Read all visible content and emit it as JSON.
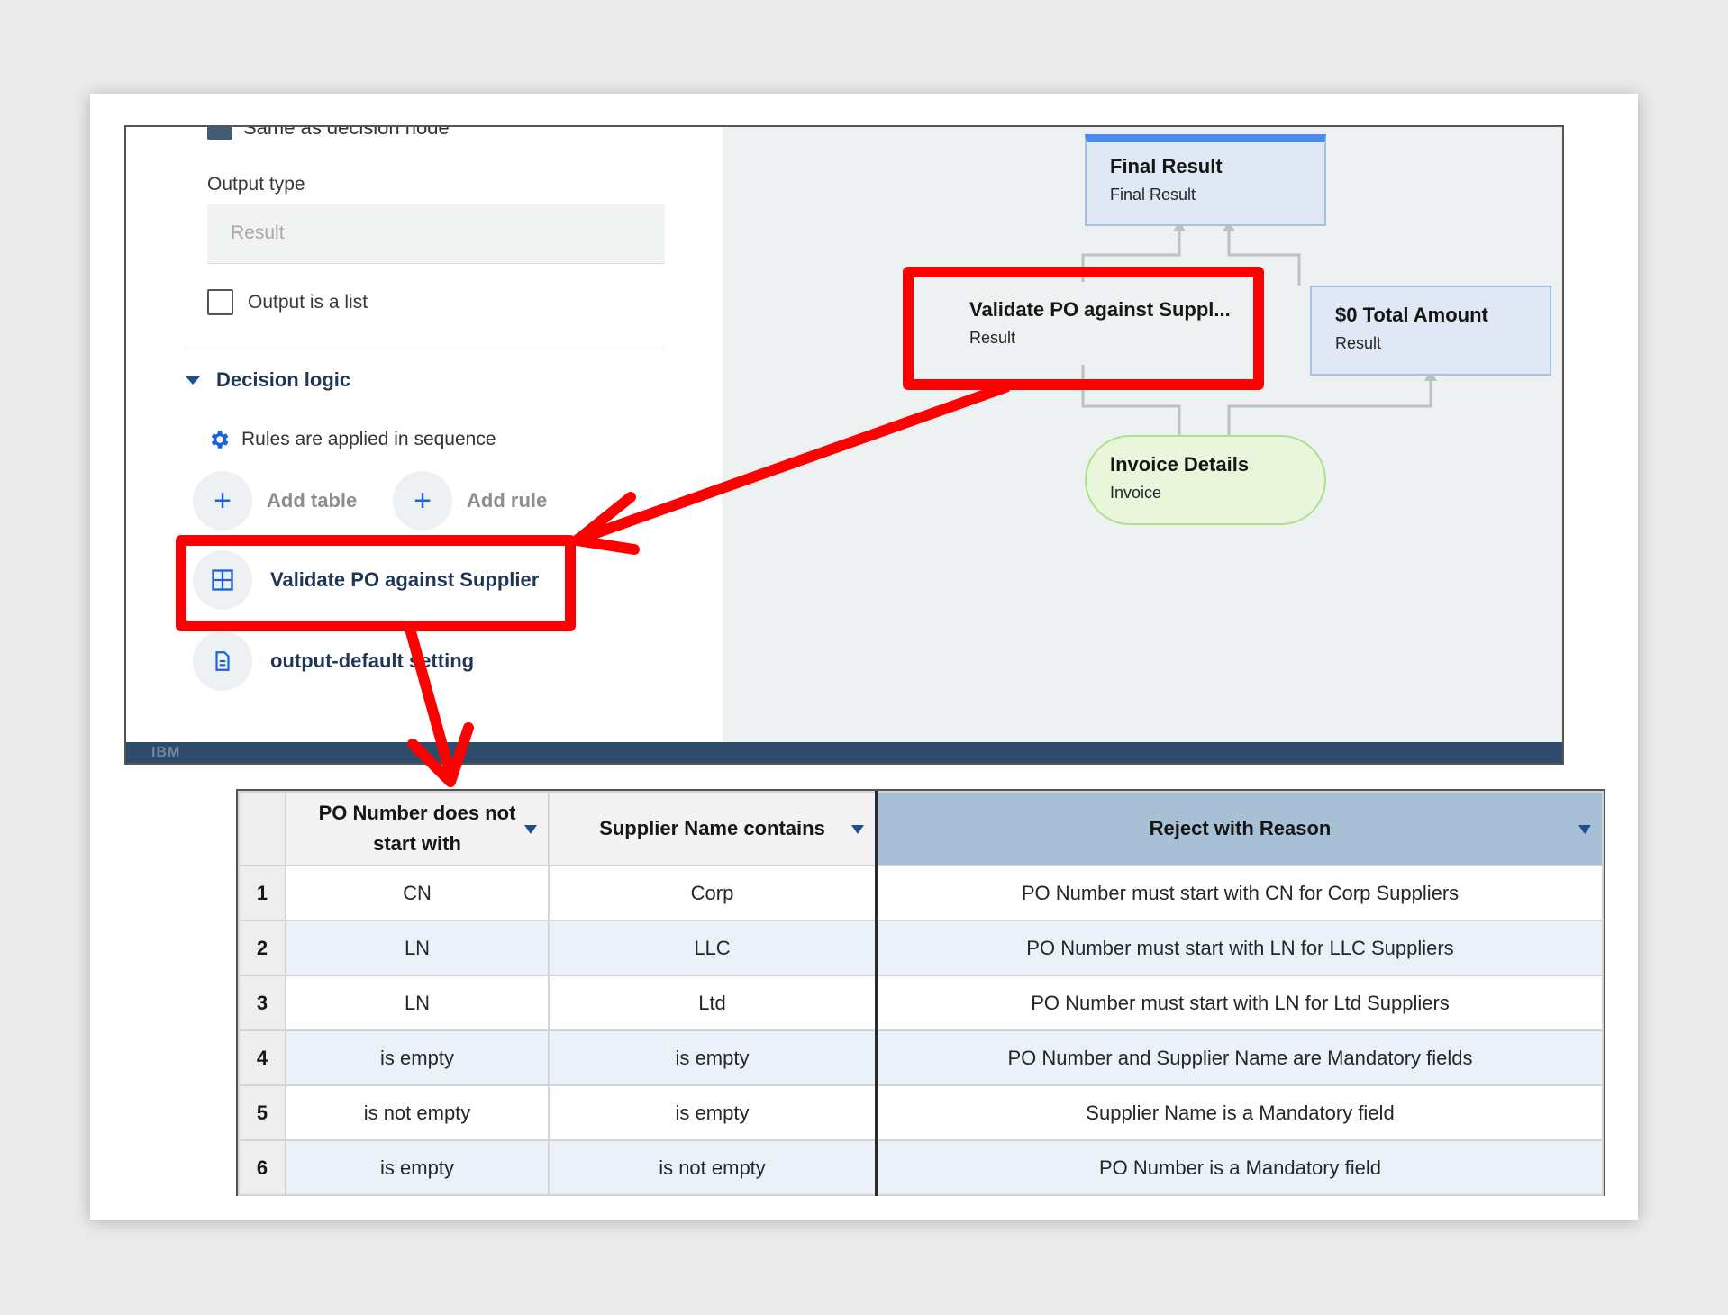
{
  "app": {
    "cut_checkbox_label": "Same as decision node",
    "output_type_label": "Output type",
    "output_type_placeholder": "Result",
    "output_is_list_label": "Output is a list",
    "decision_logic_title": "Decision logic",
    "sequence_text": "Rules are applied in sequence",
    "add_table_label": "Add table",
    "add_rule_label": "Add rule",
    "rules": [
      {
        "label": "Validate PO against Supplier",
        "icon": "table-icon"
      },
      {
        "label": "output-default setting",
        "icon": "document-icon"
      }
    ],
    "footer_logo": "IBM"
  },
  "graph": {
    "final": {
      "title": "Final Result",
      "sub": "Final Result"
    },
    "validate": {
      "title": "Validate PO against Suppl...",
      "sub": "Result"
    },
    "total": {
      "title": "$0 Total Amount",
      "sub": "Result"
    },
    "invoice": {
      "title": "Invoice Details",
      "sub": "Invoice"
    }
  },
  "annotation_color": "#ff0000",
  "table": {
    "headers": {
      "index": "",
      "po": "PO Number does not start with",
      "supplier": "Supplier Name contains",
      "reason": "Reject with Reason"
    },
    "rows": [
      {
        "n": "1",
        "po": "CN",
        "supplier": "Corp",
        "reason": "PO Number must start with CN for Corp Suppliers"
      },
      {
        "n": "2",
        "po": "LN",
        "supplier": "LLC",
        "reason": "PO Number must start with LN for LLC Suppliers"
      },
      {
        "n": "3",
        "po": "LN",
        "supplier": "Ltd",
        "reason": "PO Number must start with LN for Ltd Suppliers"
      },
      {
        "n": "4",
        "po": "is empty",
        "supplier": "is empty",
        "reason": "PO Number and Supplier Name are Mandatory fields"
      },
      {
        "n": "5",
        "po": "is not empty",
        "supplier": "is empty",
        "reason": "Supplier Name is a Mandatory field"
      },
      {
        "n": "6",
        "po": "is empty",
        "supplier": "is not empty",
        "reason": "PO Number is a Mandatory field"
      }
    ]
  }
}
